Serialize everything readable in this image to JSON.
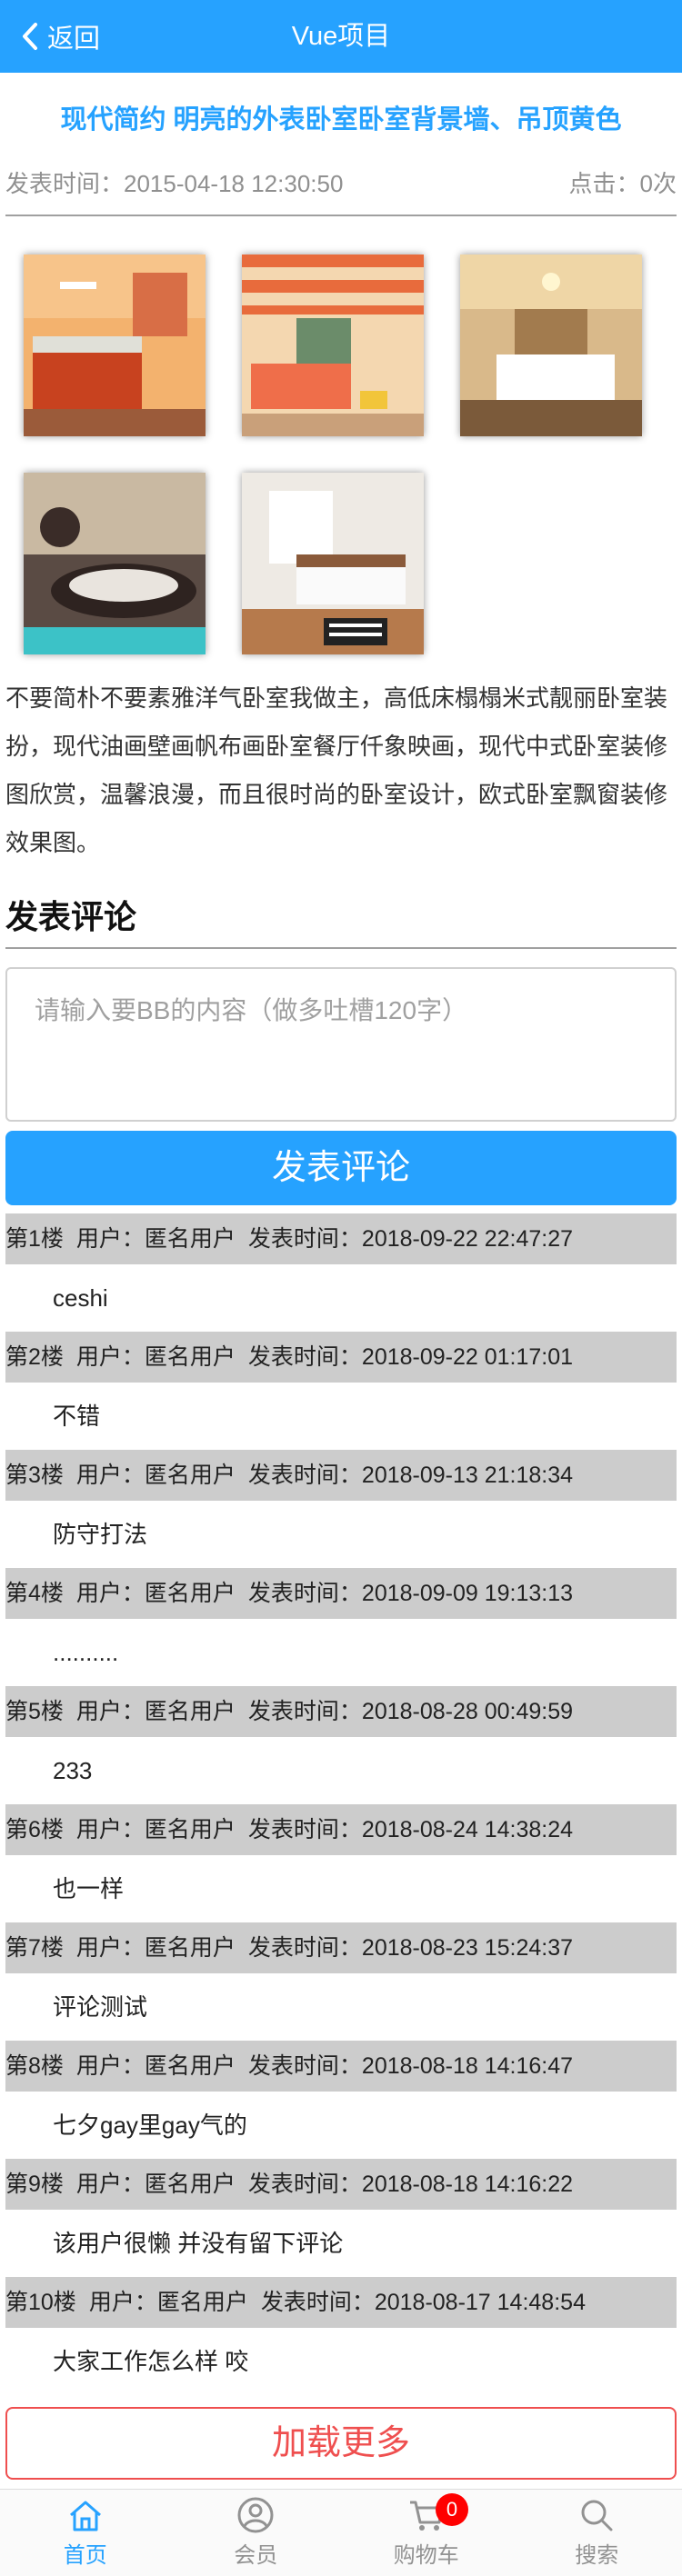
{
  "header": {
    "back_label": "返回",
    "title": "Vue项目"
  },
  "article": {
    "title": "现代简约 明亮的外表卧室卧室背景墙、吊顶黄色",
    "publish_time": "发表时间：2015-04-18 12:30:50",
    "clicks": "点击：0次",
    "images": [
      "bedroom-orange-photo",
      "bedroom-striped-ceiling-photo",
      "bedroom-warm-light-photo",
      "bedroom-round-bed-photo",
      "bedroom-bright-modern-photo"
    ],
    "content": "不要简朴不要素雅洋气卧室我做主，高低床榻榻米式靓丽卧室装扮，现代油画壁画帆布画卧室餐厅仟象映画，现代中式卧室装修图欣赏，温馨浪漫，而且很时尚的卧室设计，欧式卧室飘窗装修效果图。"
  },
  "comment_form": {
    "title": "发表评论",
    "placeholder": "请输入要BB的内容（做多吐槽120字）",
    "submit_label": "发表评论"
  },
  "comments": [
    {
      "floor": "第1楼",
      "user": "用户：匿名用户",
      "time": "发表时间：2018-09-22 22:47:27",
      "content": "ceshi"
    },
    {
      "floor": "第2楼",
      "user": "用户：匿名用户",
      "time": "发表时间：2018-09-22 01:17:01",
      "content": "不错"
    },
    {
      "floor": "第3楼",
      "user": "用户：匿名用户",
      "time": "发表时间：2018-09-13 21:18:34",
      "content": "防守打法"
    },
    {
      "floor": "第4楼",
      "user": "用户：匿名用户",
      "time": "发表时间：2018-09-09 19:13:13",
      "content": ".........."
    },
    {
      "floor": "第5楼",
      "user": "用户：匿名用户",
      "time": "发表时间：2018-08-28 00:49:59",
      "content": "233"
    },
    {
      "floor": "第6楼",
      "user": "用户：匿名用户",
      "time": "发表时间：2018-08-24 14:38:24",
      "content": "也一样"
    },
    {
      "floor": "第7楼",
      "user": "用户：匿名用户",
      "time": "发表时间：2018-08-23 15:24:37",
      "content": "评论测试"
    },
    {
      "floor": "第8楼",
      "user": "用户：匿名用户",
      "time": "发表时间：2018-08-18 14:16:47",
      "content": "七夕gay里gay气的"
    },
    {
      "floor": "第9楼",
      "user": "用户：匿名用户",
      "time": "发表时间：2018-08-18 14:16:22",
      "content": "该用户很懒 并没有留下评论"
    },
    {
      "floor": "第10楼",
      "user": "用户：匿名用户",
      "time": "发表时间：2018-08-17 14:48:54",
      "content": "大家工作怎么样 咬"
    }
  ],
  "load_more_label": "加载更多",
  "tabbar": [
    {
      "label": "首页",
      "icon": "home-icon",
      "active": true
    },
    {
      "label": "会员",
      "icon": "user-icon",
      "active": false
    },
    {
      "label": "购物车",
      "icon": "cart-icon",
      "active": false,
      "badge": "0"
    },
    {
      "label": "搜索",
      "icon": "search-icon",
      "active": false
    }
  ],
  "colors": {
    "primary": "#26a2ff",
    "danger": "#ef4f4f",
    "comment_bar": "#cccccc",
    "badge": "#ff0000"
  }
}
